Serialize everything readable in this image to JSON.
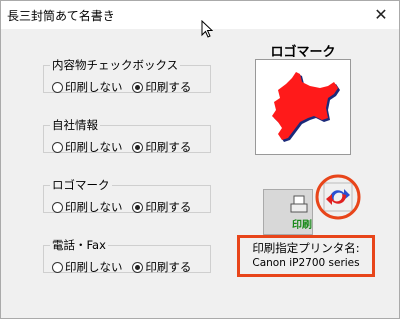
{
  "window": {
    "title": "長三封筒あて名書き"
  },
  "groups": [
    {
      "legend": "内容物チェックボックス",
      "opt_no": "印刷しない",
      "opt_yes": "印刷する",
      "selected": "opt_yes"
    },
    {
      "legend": "自社情報",
      "opt_no": "印刷しない",
      "opt_yes": "印刷する",
      "selected": "opt_yes"
    },
    {
      "legend": "ロゴマーク",
      "opt_no": "印刷しない",
      "opt_yes": "印刷する",
      "selected": "opt_yes"
    },
    {
      "legend": "電話・Fax",
      "opt_no": "印刷しない",
      "opt_yes": "印刷する",
      "selected": "opt_yes"
    }
  ],
  "logo": {
    "title": "ロゴマーク",
    "colors": {
      "map": "#ff1a1a",
      "shadow": "#1b2a7a"
    }
  },
  "printer_button": {
    "icon": "printer-icon",
    "glyph1": "印",
    "glyph2": "刷"
  },
  "swap_icon": {
    "name": "swap-printer-icon",
    "highlight": "#e8451a"
  },
  "printer": {
    "label": "印刷指定プリンタ名:",
    "name": "Canon iP2700 series"
  }
}
